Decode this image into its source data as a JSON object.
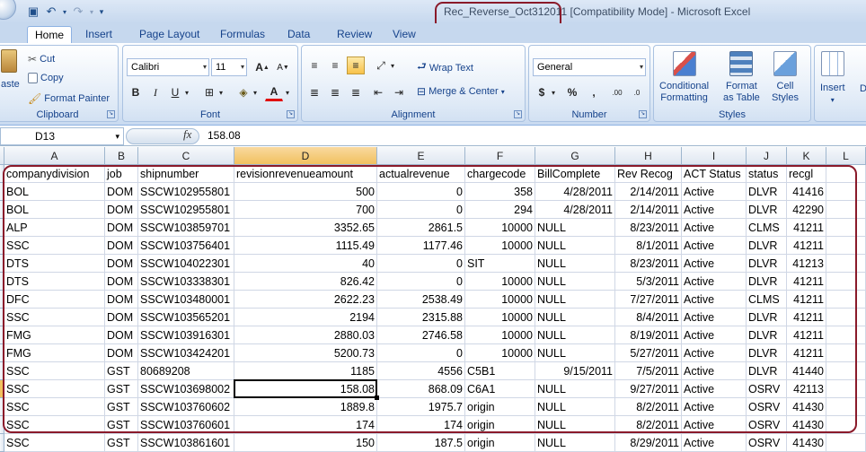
{
  "window": {
    "filename": "Rec_Reverse_Oct312011",
    "title_rest": " [Compatibility Mode] - Microsoft Excel"
  },
  "ribbon_tabs": [
    "Home",
    "Insert",
    "Page Layout",
    "Formulas",
    "Data",
    "Review",
    "View"
  ],
  "ribbon": {
    "clipboard": {
      "paste": "aste",
      "cut": "Cut",
      "copy": "Copy",
      "format_painter": "Format Painter",
      "label": "Clipboard"
    },
    "font": {
      "font_name": "Calibri",
      "font_size": "11",
      "label": "Font"
    },
    "alignment": {
      "wrap_text": "Wrap Text",
      "merge_center": "Merge & Center",
      "label": "Alignment"
    },
    "number": {
      "format": "General",
      "currency": "$",
      "percent": "%",
      "comma": ",",
      "label": "Number"
    },
    "styles": {
      "conditional": "Conditional",
      "formatting": "Formatting",
      "format": "Format",
      "as_table": "as Table",
      "cell": "Cell",
      "cell_styles": "Styles",
      "label": "Styles"
    },
    "cells": {
      "insert": "Insert"
    }
  },
  "formula_bar": {
    "name_box": "D13",
    "fx": "fx",
    "value": "158.08"
  },
  "columns": [
    "A",
    "B",
    "C",
    "D",
    "E",
    "F",
    "G",
    "H",
    "I",
    "J",
    "K",
    "L"
  ],
  "headers": [
    "companydivision",
    "job",
    "shipnumber",
    "revisionrevenueamount",
    "actualrevenue",
    "chargecode",
    "BillComplete",
    "Rev Recog",
    "ACT Status",
    "status",
    "recgl"
  ],
  "rows": [
    [
      "BOL",
      "DOM",
      "SSCW102955801",
      "500",
      "0",
      "358",
      "4/28/2011",
      "2/14/2011",
      "Active",
      "DLVR",
      "41416"
    ],
    [
      "BOL",
      "DOM",
      "SSCW102955801",
      "700",
      "0",
      "294",
      "4/28/2011",
      "2/14/2011",
      "Active",
      "DLVR",
      "42290"
    ],
    [
      "ALP",
      "DOM",
      "SSCW103859701",
      "3352.65",
      "2861.5",
      "10000",
      "NULL",
      "8/23/2011",
      "Active",
      "CLMS",
      "41211"
    ],
    [
      "SSC",
      "DOM",
      "SSCW103756401",
      "1115.49",
      "1177.46",
      "10000",
      "NULL",
      "8/1/2011",
      "Active",
      "DLVR",
      "41211"
    ],
    [
      "DTS",
      "DOM",
      "SSCW104022301",
      "40",
      "0",
      "SIT",
      "NULL",
      "8/23/2011",
      "Active",
      "DLVR",
      "41213"
    ],
    [
      "DTS",
      "DOM",
      "SSCW103338301",
      "826.42",
      "0",
      "10000",
      "NULL",
      "5/3/2011",
      "Active",
      "DLVR",
      "41211"
    ],
    [
      "DFC",
      "DOM",
      "SSCW103480001",
      "2622.23",
      "2538.49",
      "10000",
      "NULL",
      "7/27/2011",
      "Active",
      "CLMS",
      "41211"
    ],
    [
      "SSC",
      "DOM",
      "SSCW103565201",
      "2194",
      "2315.88",
      "10000",
      "NULL",
      "8/4/2011",
      "Active",
      "DLVR",
      "41211"
    ],
    [
      "FMG",
      "DOM",
      "SSCW103916301",
      "2880.03",
      "2746.58",
      "10000",
      "NULL",
      "8/19/2011",
      "Active",
      "DLVR",
      "41211"
    ],
    [
      "FMG",
      "DOM",
      "SSCW103424201",
      "5200.73",
      "0",
      "10000",
      "NULL",
      "5/27/2011",
      "Active",
      "DLVR",
      "41211"
    ],
    [
      "SSC",
      "GST",
      "80689208",
      "1185",
      "4556",
      "C5B1",
      "9/15/2011",
      "7/5/2011",
      "Active",
      "DLVR",
      "41440"
    ],
    [
      "SSC",
      "GST",
      "SSCW103698002",
      "158.08",
      "868.09",
      "C6A1",
      "NULL",
      "9/27/2011",
      "Active",
      "OSRV",
      "42113"
    ],
    [
      "SSC",
      "GST",
      "SSCW103760602",
      "1889.8",
      "1975.7",
      "origin",
      "NULL",
      "8/2/2011",
      "Active",
      "OSRV",
      "41430"
    ],
    [
      "SSC",
      "GST",
      "SSCW103760601",
      "174",
      "174",
      "origin",
      "NULL",
      "8/2/2011",
      "Active",
      "OSRV",
      "41430"
    ],
    [
      "SSC",
      "GST",
      "SSCW103861601",
      "150",
      "187.5",
      "origin",
      "NULL",
      "8/29/2011",
      "Active",
      "OSRV",
      "41430"
    ]
  ]
}
